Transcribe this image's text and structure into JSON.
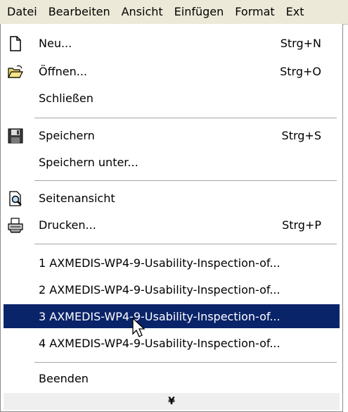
{
  "menubar": {
    "items": [
      {
        "label": "Datei"
      },
      {
        "label": "Bearbeiten"
      },
      {
        "label": "Ansicht"
      },
      {
        "label": "Einfügen"
      },
      {
        "label": "Format"
      },
      {
        "label": "Ext"
      }
    ]
  },
  "menu": {
    "new": {
      "label": "Neu...",
      "shortcut": "Strg+N",
      "icon": "new-document-icon"
    },
    "open": {
      "label": "Öffnen...",
      "shortcut": "Strg+O",
      "icon": "open-folder-icon"
    },
    "close": {
      "label": "Schließen"
    },
    "save": {
      "label": "Speichern",
      "shortcut": "Strg+S",
      "icon": "floppy-disk-icon"
    },
    "save_as": {
      "label": "Speichern unter..."
    },
    "preview": {
      "label": "Seitenansicht",
      "icon": "print-preview-icon"
    },
    "print": {
      "label": "Drucken...",
      "shortcut": "Strg+P",
      "icon": "printer-icon"
    },
    "recent": [
      {
        "label": "1 AXMEDIS-WP4-9-Usability-Inspection-of..."
      },
      {
        "label": "2 AXMEDIS-WP4-9-Usability-Inspection-of..."
      },
      {
        "label": "3 AXMEDIS-WP4-9-Usability-Inspection-of..."
      },
      {
        "label": "4 AXMEDIS-WP4-9-Usability-Inspection-of..."
      }
    ],
    "exit": {
      "label": "Beenden"
    },
    "expand": {
      "icon": "double-chevron-down-icon",
      "glyph": "¥"
    },
    "selected_color": "#0a246a"
  }
}
